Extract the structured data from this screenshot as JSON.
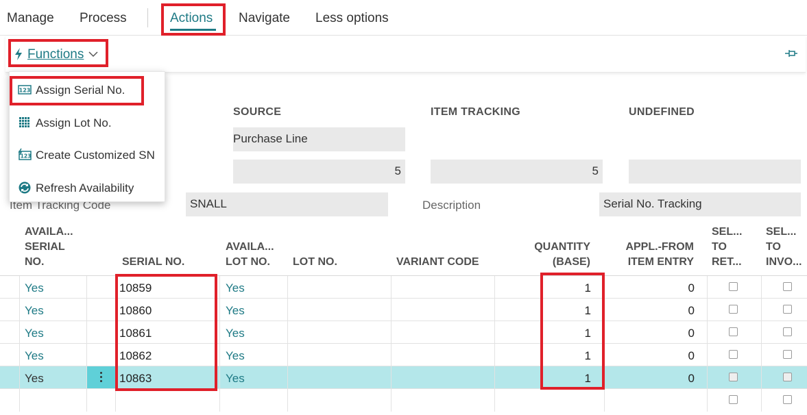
{
  "menu": {
    "manage": "Manage",
    "process": "Process",
    "actions": "Actions",
    "navigate": "Navigate",
    "less_options": "Less options"
  },
  "ribbon": {
    "functions_label": "Functions",
    "functions_icon": "lightning-icon",
    "pin_icon": "pin-icon"
  },
  "dropdown": {
    "items": [
      {
        "label": "Assign Serial No.",
        "icon": "serial-number-icon"
      },
      {
        "label": "Assign Lot No.",
        "icon": "lot-grid-icon"
      },
      {
        "label": "Create Customized SN",
        "icon": "customized-serial-icon"
      },
      {
        "label": "Refresh Availability",
        "icon": "refresh-icon"
      }
    ]
  },
  "header": {
    "source_caption": "SOURCE",
    "item_tracking_caption": "ITEM TRACKING",
    "undefined_caption": "UNDEFINED",
    "source_type": "Purchase Line",
    "source_qty": "5",
    "item_tracking_qty": "5",
    "undefined_qty": "",
    "item_tracking_code_label": "Item Tracking Code",
    "item_tracking_code_value": "SNALL",
    "description_label": "Description",
    "description_value": "Serial No. Tracking"
  },
  "grid": {
    "headers": {
      "avail_serial": [
        "AVAILA...",
        "SERIAL",
        "NO."
      ],
      "serial_no": "SERIAL NO.",
      "avail_lot": [
        "AVAILA...",
        "LOT NO."
      ],
      "lot_no": "LOT NO.",
      "variant_code": "VARIANT CODE",
      "quantity_base": [
        "QUANTITY",
        "(BASE)"
      ],
      "appl_from": [
        "APPL.-FROM",
        "ITEM ENTRY"
      ],
      "sel_to_ret": [
        "SEL...",
        "TO",
        "RET..."
      ],
      "sel_to_invo": [
        "SEL...",
        "TO",
        "INVO..."
      ]
    },
    "rows": [
      {
        "avail_serial": "Yes",
        "serial_no": "10859",
        "avail_lot": "Yes",
        "quantity": "1",
        "appl_from": "0"
      },
      {
        "avail_serial": "Yes",
        "serial_no": "10860",
        "avail_lot": "Yes",
        "quantity": "1",
        "appl_from": "0"
      },
      {
        "avail_serial": "Yes",
        "serial_no": "10861",
        "avail_lot": "Yes",
        "quantity": "1",
        "appl_from": "0"
      },
      {
        "avail_serial": "Yes",
        "serial_no": "10862",
        "avail_lot": "Yes",
        "quantity": "1",
        "appl_from": "0"
      },
      {
        "avail_serial": "Yes",
        "serial_no": "10863",
        "avail_lot": "Yes",
        "quantity": "1",
        "appl_from": "0"
      }
    ]
  },
  "colors": {
    "accent": "#1e7a85",
    "highlight": "#e0202a",
    "selected_row": "#b4e7ea"
  }
}
